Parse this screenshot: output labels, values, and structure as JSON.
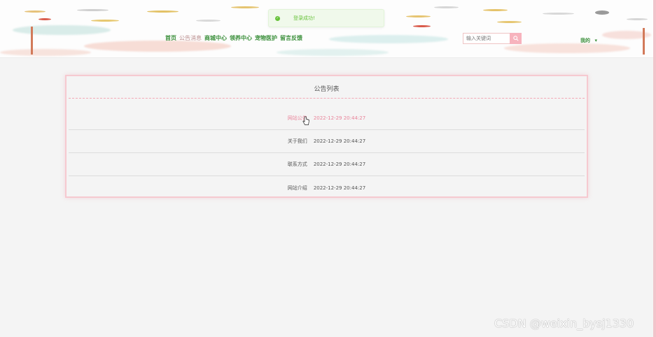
{
  "toast": {
    "message": "登录成功!"
  },
  "nav": {
    "items": [
      {
        "label": "首页",
        "active": false
      },
      {
        "label": "公告消息",
        "active": true
      },
      {
        "label": "商城中心",
        "active": false
      },
      {
        "label": "领养中心",
        "active": false
      },
      {
        "label": "宠物医护",
        "active": false
      },
      {
        "label": "留言反馈",
        "active": false
      }
    ]
  },
  "search": {
    "placeholder": "输入关键词"
  },
  "user": {
    "menu_label": "我的",
    "menu_arrow": "▾"
  },
  "notice_list": {
    "title": "公告列表",
    "items": [
      {
        "title": "网站公告",
        "time": "2022-12-29 20:44:27"
      },
      {
        "title": "关于我们",
        "time": "2022-12-29 20:44:27"
      },
      {
        "title": "联系方式",
        "time": "2022-12-29 20:44:27"
      },
      {
        "title": "网站介绍",
        "time": "2022-12-29 20:44:27"
      }
    ]
  },
  "watermark": "CSDN @weixin_bysj1330",
  "colors": {
    "accent_pink": "#f7b3bd",
    "nav_green": "#3a8f3a",
    "hover_pink": "#e9849a",
    "toast_green": "#67c23a"
  }
}
